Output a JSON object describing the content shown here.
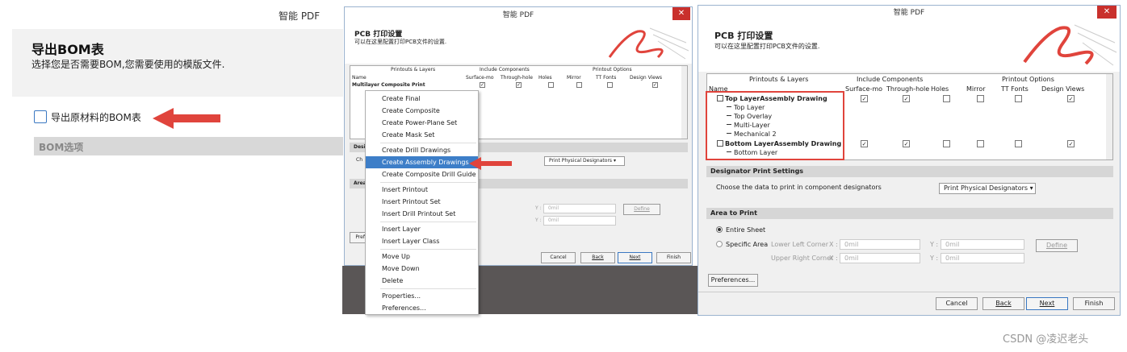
{
  "left_panel": {
    "window_title": "智能 PDF",
    "heading": "导出BOM表",
    "subtitle": "选择您是否需要BOM,您需要使用的模版文件.",
    "checkbox_label": "导出原材料的BOM表",
    "section_title": "BOM选项"
  },
  "middle_dialog": {
    "window_title": "智能 PDF",
    "close_label": "✕",
    "header_title": "PCB 打印设置",
    "header_subtitle": "可以在这里配置打印PCB文件的设置.",
    "col_printouts": "Printouts & Layers",
    "col_include": "Include Components",
    "col_options": "Printout Options",
    "col_name": "Name",
    "col_surface": "Surface-mo",
    "col_through": "Through-hole",
    "col_holes": "Holes",
    "col_mirror": "Mirror",
    "col_ttfonts": "TT Fonts",
    "col_design": "Design Views",
    "row1": "Multilayer Composite Print",
    "sect_designator": "Desig",
    "row_choose": "Ch",
    "sect_area": "Area",
    "dropdown_value": "Print Physical Designators",
    "y_label1": "Y :",
    "y_value1": "0mil",
    "y_label2": "Y :",
    "y_value2": "0mil",
    "define": "Define",
    "pref": "Prefe",
    "btn_cancel": "Cancel",
    "btn_back": "Back",
    "btn_next": "Next",
    "btn_finish": "Finish",
    "check": "✓"
  },
  "context_menu": {
    "items": [
      "Create Final",
      "Create Composite",
      "Create Power-Plane Set",
      "Create Mask Set",
      "Create Drill Drawings",
      "Create Assembly Drawings",
      "Create Composite Drill Guide",
      "Insert Printout",
      "Insert Printout Set",
      "Insert Drill Printout Set",
      "Insert Layer",
      "Insert Layer Class",
      "Move Up",
      "Move Down",
      "Delete",
      "Properties...",
      "Preferences..."
    ]
  },
  "right_dialog": {
    "window_title": "智能 PDF",
    "close_label": "✕",
    "header_title": "PCB 打印设置",
    "header_subtitle": "可以在这里配置打印PCB文件的设置.",
    "col_printouts": "Printouts & Layers",
    "col_include": "Include Components",
    "col_options": "Printout Options",
    "col_name": "Name",
    "col_surface": "Surface-mo",
    "col_through": "Through-hole",
    "col_holes": "Holes",
    "col_mirror": "Mirror",
    "col_ttfonts": "TT Fonts",
    "col_design": "Design Views",
    "tree_top": "Top LayerAssembly Drawing",
    "tree_top_layer": "Top Layer",
    "tree_top_overlay": "Top Overlay",
    "tree_multi": "Multi-Layer",
    "tree_mech2": "Mechanical 2",
    "tree_bottom": "Bottom LayerAssembly Drawing",
    "tree_bottom_layer": "Bottom Layer",
    "sect_designator": "Designator Print Settings",
    "choose_label": "Choose the data to print in component designators",
    "dropdown_value": "Print Physical Designators",
    "sect_area": "Area to Print",
    "entire_sheet": "Entire Sheet",
    "specific_area": "Specific Area",
    "lower_left": "Lower Left Corner",
    "upper_right": "Upper Right Corner",
    "x_label": "X :",
    "y_label": "Y :",
    "zero_mil": "0mil",
    "define": "Define",
    "preferences": "Preferences...",
    "btn_cancel": "Cancel",
    "btn_back": "Back",
    "btn_next": "Next",
    "btn_finish": "Finish",
    "check": "✓"
  },
  "watermark": "CSDN @凌迟老头",
  "colors": {
    "accent_red": "#e0443c",
    "menu_highlight": "#3d7ec8",
    "close_red": "#c9302c"
  }
}
